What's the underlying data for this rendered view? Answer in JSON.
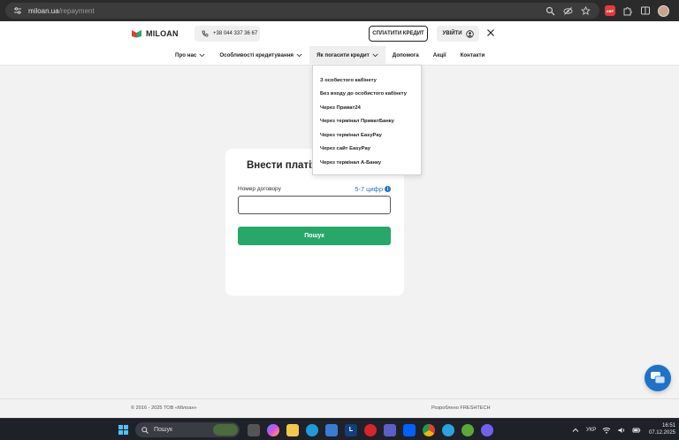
{
  "browser": {
    "url_domain": "miloan.ua",
    "url_path": "/repayment",
    "extension_badge": "ABP"
  },
  "header": {
    "logo_text": "MILOAN",
    "phone": "+38 044 337 36 67",
    "pay_button": "СПЛАТИТИ КРЕДИТ",
    "login_button": "УВІЙТИ"
  },
  "nav": {
    "items": [
      {
        "label": "Про нас",
        "has_dropdown": true
      },
      {
        "label": "Особливості кредитування",
        "has_dropdown": true
      },
      {
        "label": "Як погасити кредит",
        "has_dropdown": true,
        "active": true
      },
      {
        "label": "Допомога",
        "has_dropdown": false
      },
      {
        "label": "Акції",
        "has_dropdown": false
      },
      {
        "label": "Контакти",
        "has_dropdown": false
      }
    ]
  },
  "dropdown": {
    "items": [
      "З особистого кабінету",
      "Без входу до особистого кабінету",
      "Через Приват24",
      "Через термінал ПриватБанку",
      "Через термінал EasyPay",
      "Через сайт EasyPay",
      "Через термінал А-Банку"
    ]
  },
  "payment": {
    "title": "Внести платіж",
    "contract_label": "Номер договору",
    "hint": "5-7 цифр",
    "contract_value": "",
    "search_button": "Пошук"
  },
  "footer": {
    "copyright": "© 2016 - 2025 ТОВ «Мілоан»",
    "developed": "Розроблено FRESHTECH"
  },
  "taskbar": {
    "search_placeholder": "Пошук",
    "language": "УКР",
    "time": "16:51",
    "date": "07.12.2025"
  },
  "colors": {
    "brand_red": "#e23b3b",
    "brand_green": "#27a869",
    "link_blue": "#1e73c8"
  }
}
